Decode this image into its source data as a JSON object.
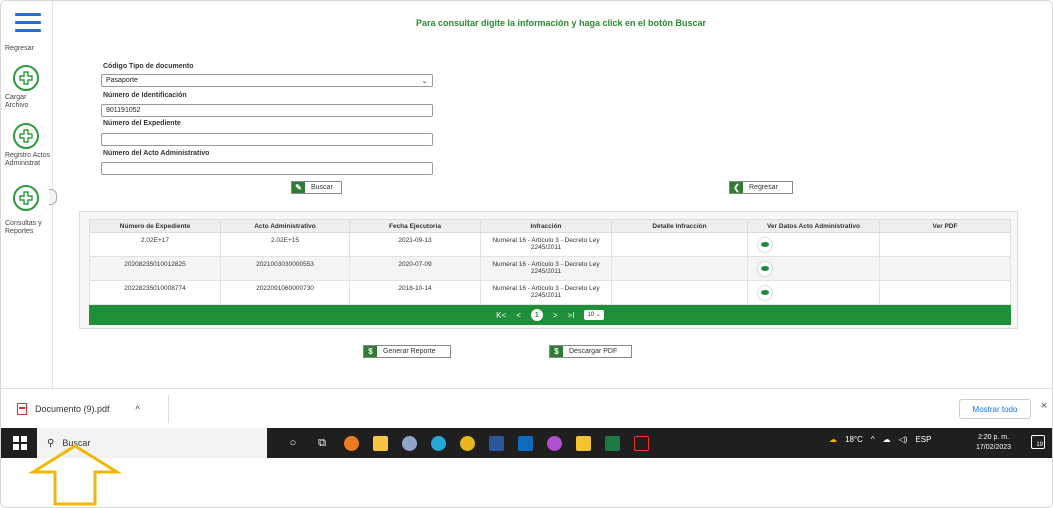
{
  "sidebar": {
    "items": [
      {
        "label": "Regresar"
      },
      {
        "label": "Cargar Archivo"
      },
      {
        "label": "Registro Actos Administrat"
      },
      {
        "label": "Consultas y Reportes"
      }
    ]
  },
  "main": {
    "heading": "Para consultar digite la información y haga click en el botón Buscar",
    "form": {
      "tipo_label": "Código Tipo de documento",
      "tipo_value": "Pasaporte",
      "numero_label": "Número de Identificación",
      "numero_value": "901191052",
      "expediente_label": "Número del Expediente",
      "expediente_value": "",
      "acto_label": "Número del Acto Administrativo",
      "acto_value": ""
    },
    "buttons": {
      "buscar": "Buscar",
      "regresar": "Regresar",
      "generar": "Generar Reporte",
      "descargar": "Descargar PDF"
    },
    "table": {
      "headers": [
        "Número de Expediente",
        "Acto Administrativo",
        "Fecha Ejecutoria",
        "Infracción",
        "Detalle Infracción",
        "Ver Datos Acto Administrativo",
        "Ver PDF"
      ],
      "rows": [
        {
          "expediente": "2.02E+17",
          "acto": "2.02E+15",
          "fecha": "2021-09-13",
          "infraccion": "Numeral 16 - Artículo 3 - Decreto Ley 2245/2011",
          "detalle": ""
        },
        {
          "expediente": "20208235010012825",
          "acto": "2021003030000553",
          "fecha": "2020-07-09",
          "infraccion": "Numeral 16 - Artículo 3 - Decreto Ley 2245/2011",
          "detalle": ""
        },
        {
          "expediente": "20228235010008774",
          "acto": "2022091060000730",
          "fecha": "2018-10-14",
          "infraccion": "Numeral 16 - Artículo 3 - Decreto Ley 2245/2011",
          "detalle": ""
        }
      ]
    },
    "pager": {
      "first": "K<",
      "prev": "<",
      "current": "1",
      "next": ">",
      "last": ">I",
      "page_size": "10"
    }
  },
  "download_bar": {
    "file_name": "Documento (9).pdf",
    "chevron": "^",
    "show_all": "Mostrar todo",
    "close": "×"
  },
  "taskbar": {
    "search_placeholder": "Buscar",
    "weather": "18°C",
    "language": "ESP",
    "time": "2:20 p. m.",
    "date": "17/02/2023",
    "notification_count": "19"
  },
  "colors": {
    "accent_green": "#1f8f3a",
    "heading_green": "#2a8a32",
    "arrow_yellow": "#f2b705"
  }
}
